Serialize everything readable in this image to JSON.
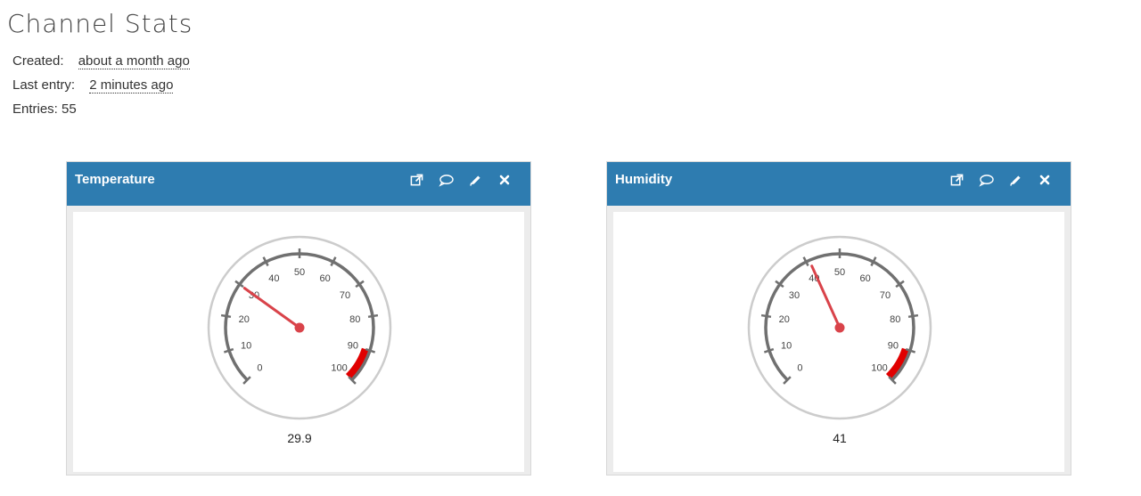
{
  "page": {
    "title": "Channel Stats"
  },
  "stats": {
    "created_label": "Created:",
    "created_value": "about a month ago",
    "last_entry_label": "Last entry:",
    "last_entry_value": "2 minutes ago",
    "entries_text": "Entries: 55"
  },
  "widgets": [
    {
      "title": "Temperature",
      "icons": [
        "external-link-icon",
        "comment-icon",
        "pencil-icon",
        "close-icon"
      ],
      "chart_data": {
        "type": "gauge",
        "min": 0,
        "max": 100,
        "value": 29.9,
        "value_label": "29.9",
        "ticks": [
          "0",
          "10",
          "20",
          "30",
          "40",
          "50",
          "60",
          "70",
          "80",
          "90",
          "100"
        ],
        "red_band": [
          90,
          100
        ]
      }
    },
    {
      "title": "Humidity",
      "icons": [
        "external-link-icon",
        "comment-icon",
        "pencil-icon",
        "close-icon"
      ],
      "chart_data": {
        "type": "gauge",
        "min": 0,
        "max": 100,
        "value": 41,
        "value_label": "41",
        "ticks": [
          "0",
          "10",
          "20",
          "30",
          "40",
          "50",
          "60",
          "70",
          "80",
          "90",
          "100"
        ],
        "red_band": [
          90,
          100
        ]
      }
    }
  ],
  "colors": {
    "header": "#2e7cb0",
    "needle": "#d9434a",
    "band": "#e00000",
    "scale": "#707070",
    "rim": "#cccccc"
  }
}
